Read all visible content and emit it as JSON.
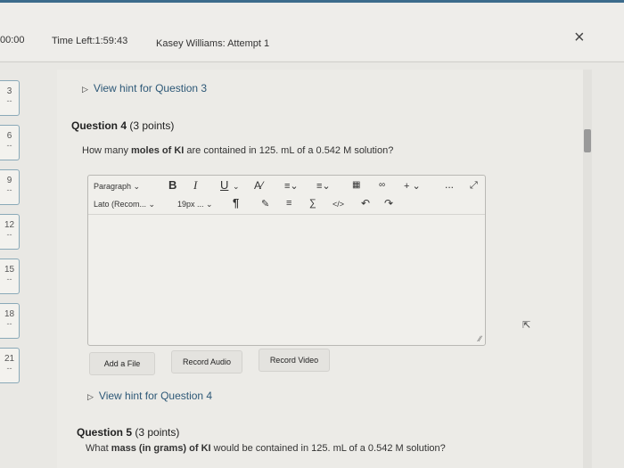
{
  "header": {
    "clock": "00:00",
    "time_left": "Time Left:1:59:43",
    "attempt": "Kasey Williams: Attempt 1",
    "close_glyph": "×"
  },
  "question_nav": [
    {
      "number": "3",
      "status": "--"
    },
    {
      "number": "6",
      "status": "--"
    },
    {
      "number": "9",
      "status": "--"
    },
    {
      "number": "12",
      "status": "--"
    },
    {
      "number": "15",
      "status": "--"
    },
    {
      "number": "18",
      "status": "--"
    },
    {
      "number": "21",
      "status": "--"
    }
  ],
  "hint_q3": "View hint for Question 3",
  "question4": {
    "label": "Question 4",
    "points": "(3 points)",
    "text_before": "How many ",
    "text_bold": "moles of KI",
    "text_after": " are contained in 125. mL of a 0.542 M solution?"
  },
  "editor": {
    "paragraph": "Paragraph",
    "font": "Lato (Recom...",
    "size": "19px ...",
    "bold": "B",
    "italic": "I",
    "underline": "U",
    "more": "..."
  },
  "buttons": {
    "add_file": "Add a File",
    "record_audio": "Record Audio",
    "record_video": "Record Video"
  },
  "hint_q4": "View hint for Question 4",
  "question5": {
    "label": "Question 5",
    "points": "(3 points)",
    "text_before": "What ",
    "text_bold": "mass (in grams) of KI",
    "text_after": " would be contained in 125. mL of a 0.542 M solution?"
  },
  "icons": {
    "hint_toggle": "triangle-right-icon",
    "close": "close-icon",
    "fullscreen": "fullscreen-icon"
  }
}
